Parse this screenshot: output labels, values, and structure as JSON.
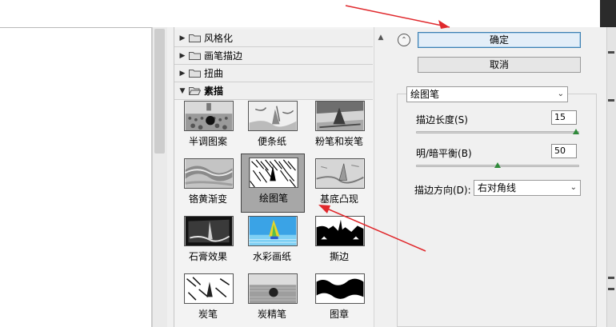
{
  "categories": [
    {
      "label": "风格化",
      "open": false
    },
    {
      "label": "画笔描边",
      "open": false
    },
    {
      "label": "扭曲",
      "open": false
    },
    {
      "label": "素描",
      "open": true
    }
  ],
  "filters": [
    {
      "label": "半调图案",
      "selected": false,
      "icon": "halftone-pattern-thumbnail"
    },
    {
      "label": "便条纸",
      "selected": false,
      "icon": "note-paper-thumbnail"
    },
    {
      "label": "粉笔和炭笔",
      "selected": false,
      "icon": "chalk-charcoal-thumbnail"
    },
    {
      "label": "铬黄渐变",
      "selected": false,
      "icon": "chrome-thumbnail"
    },
    {
      "label": "绘图笔",
      "selected": true,
      "icon": "graphic-pen-thumbnail"
    },
    {
      "label": "基底凸现",
      "selected": false,
      "icon": "bas-relief-thumbnail"
    },
    {
      "label": "石膏效果",
      "selected": false,
      "icon": "plaster-thumbnail"
    },
    {
      "label": "水彩画纸",
      "selected": false,
      "icon": "water-paper-thumbnail"
    },
    {
      "label": "撕边",
      "selected": false,
      "icon": "torn-edges-thumbnail"
    },
    {
      "label": "炭笔",
      "selected": false,
      "icon": "charcoal-thumbnail"
    },
    {
      "label": "炭精笔",
      "selected": false,
      "icon": "conte-crayon-thumbnail"
    },
    {
      "label": "图章",
      "selected": false,
      "icon": "stamp-thumbnail"
    }
  ],
  "buttons": {
    "ok": "确定",
    "cancel": "取消"
  },
  "filter_select": {
    "value": "绘图笔"
  },
  "params": {
    "stroke_length": {
      "label": "描边长度(S)",
      "value": "15",
      "level": 1.0
    },
    "light_dark_balance": {
      "label": "明/暗平衡(B)",
      "value": "50",
      "level": 0.5
    },
    "stroke_direction": {
      "label": "描边方向(D):",
      "value": "右对角线"
    }
  },
  "colors": {
    "accent_blue": "#3c7fb1",
    "slider_knob": "#2f8a3a",
    "annotation_red": "#e0282c"
  }
}
